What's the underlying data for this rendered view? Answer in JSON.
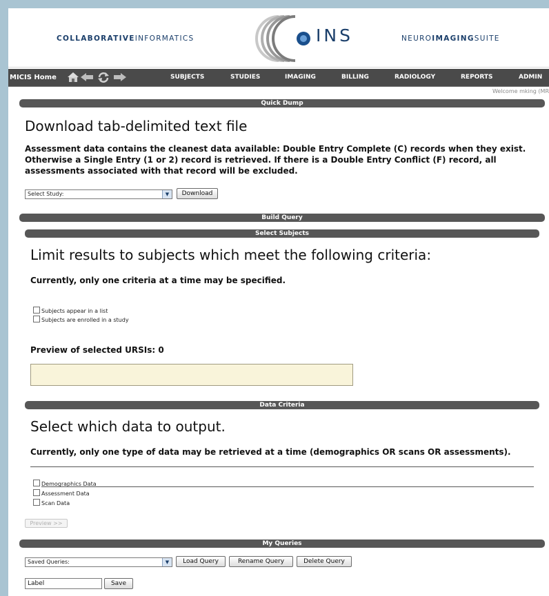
{
  "header": {
    "brand_left_bold": "COLLABORATIVE",
    "brand_left_rest": "INFORMATICS",
    "logo_text": "INS",
    "brand_right_thin": "NEURO",
    "brand_right_bold": "IMAGING",
    "brand_right_rest": "SUITE"
  },
  "nav": {
    "home_label": "MICIS Home",
    "icons": [
      "home-icon",
      "back-arrow-icon",
      "refresh-icon",
      "forward-arrow-icon"
    ],
    "items": [
      "SUBJECTS",
      "STUDIES",
      "IMAGING",
      "BILLING",
      "RADIOLOGY",
      "REPORTS",
      "ADMIN"
    ],
    "welcome": "Welcome mking (MR"
  },
  "quick_dump": {
    "bar_title": "Quick Dump",
    "heading": "Download tab-delimited text file",
    "description": "Assessment data contains the cleanest data available: Double Entry Complete (C) records when they exist. Otherwise a Single Entry (1 or 2) record is retrieved. If there is a Double Entry Conflict (F) record, all assessments associated with that record will be excluded.",
    "select_study": "Select Study:",
    "download_label": "Download"
  },
  "build_query": {
    "bar_title": "Build Query",
    "select_subjects": {
      "bar_title": "Select Subjects",
      "heading": "Limit results to subjects which meet the following criteria:",
      "note": "Currently, only one criteria at a time may be specified.",
      "checkboxes": [
        "Subjects appear in a list",
        "Subjects are enrolled in a study"
      ],
      "preview_label": "Preview of selected URSIs: 0"
    },
    "data_criteria": {
      "bar_title": "Data Criteria",
      "heading": "Select which data to output.",
      "note": "Currently, only one type of data may be retrieved at a time (demographics OR scans OR assessments).",
      "checkboxes": [
        "Demographics Data",
        "Assessment Data",
        "Scan Data"
      ],
      "preview_button": "Preview  >>"
    }
  },
  "my_queries": {
    "bar_title": "My Queries",
    "saved_select": "Saved Queries:",
    "load_label": "Load Query",
    "rename_label": "Rename Query",
    "delete_label": "Delete Query",
    "label_value": "Label",
    "save_label": "Save"
  }
}
